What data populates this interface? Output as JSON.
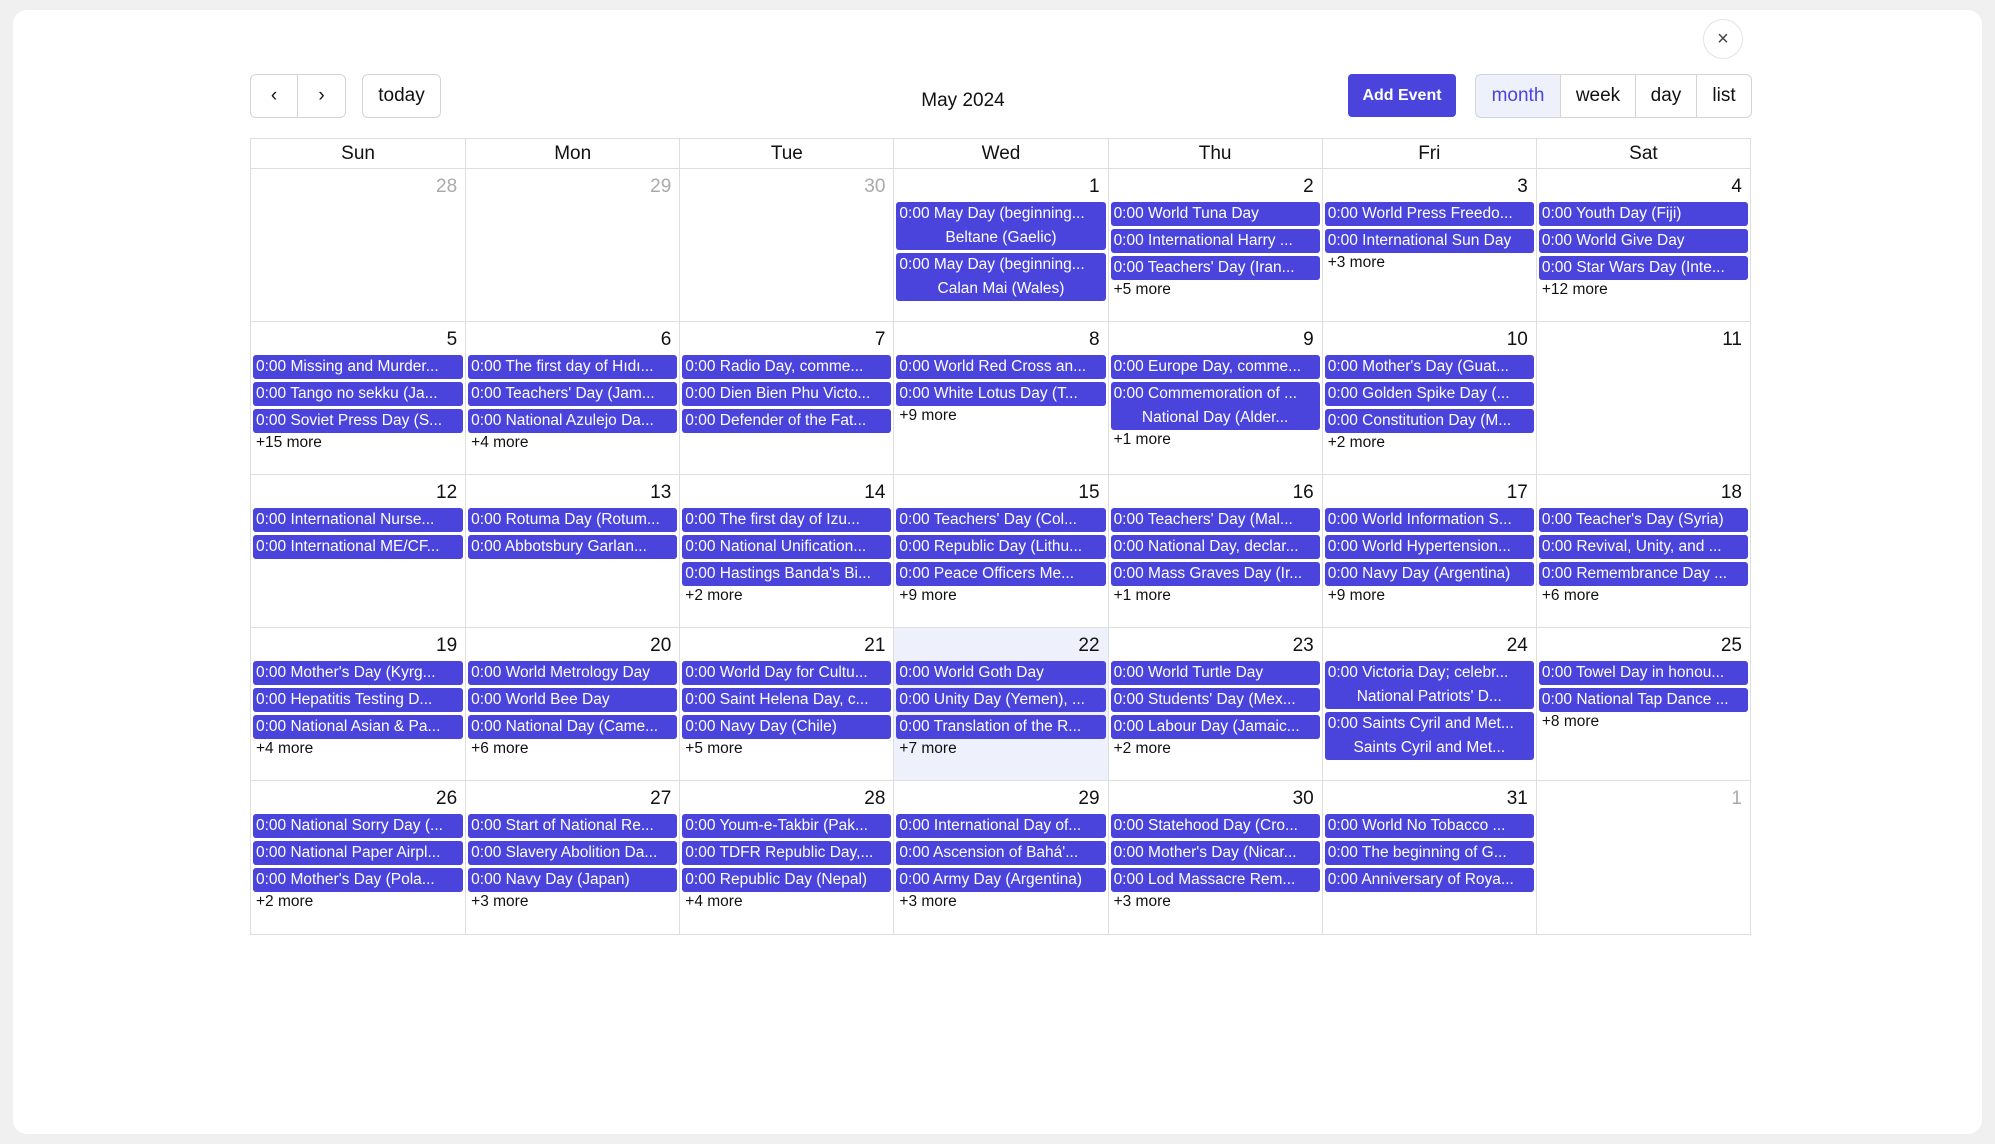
{
  "close_label": "×",
  "toolbar": {
    "prev": "‹",
    "next": "›",
    "today": "today",
    "title": "May 2024",
    "add_event": "Add Event",
    "views": [
      "month",
      "week",
      "day",
      "list"
    ],
    "active_view": "month"
  },
  "accent": "#4a44dd",
  "dow": [
    "Sun",
    "Mon",
    "Tue",
    "Wed",
    "Thu",
    "Fri",
    "Sat"
  ],
  "weeks": [
    [
      {
        "day": "28",
        "other": true,
        "events": [],
        "more": ""
      },
      {
        "day": "29",
        "other": true,
        "events": [],
        "more": ""
      },
      {
        "day": "30",
        "other": true,
        "events": [],
        "more": ""
      },
      {
        "day": "1",
        "events": [
          [
            "0:00 May Day (beginning...",
            "Beltane (Gaelic)"
          ],
          [
            "0:00 May Day (beginning...",
            "Calan Mai (Wales)"
          ]
        ],
        "more": ""
      },
      {
        "day": "2",
        "events": [
          "0:00 World Tuna Day",
          "0:00 International Harry ...",
          "0:00 Teachers' Day (Iran..."
        ],
        "more": "+5 more"
      },
      {
        "day": "3",
        "events": [
          "0:00 World Press Freedo...",
          "0:00 International Sun Day"
        ],
        "more": "+3 more"
      },
      {
        "day": "4",
        "events": [
          "0:00 Youth Day (Fiji)",
          "0:00 World Give Day",
          "0:00 Star Wars Day (Inte..."
        ],
        "more": "+12 more"
      }
    ],
    [
      {
        "day": "5",
        "events": [
          "0:00 Missing and Murder...",
          "0:00 Tango no sekku (Ja...",
          "0:00 Soviet Press Day (S..."
        ],
        "more": "+15 more"
      },
      {
        "day": "6",
        "events": [
          "0:00 The first day of Hıdı...",
          "0:00 Teachers' Day (Jam...",
          "0:00 National Azulejo Da..."
        ],
        "more": "+4 more"
      },
      {
        "day": "7",
        "events": [
          "0:00 Radio Day, comme...",
          "0:00 Dien Bien Phu Victo...",
          "0:00 Defender of the Fat..."
        ],
        "more": ""
      },
      {
        "day": "8",
        "events": [
          "0:00 World Red Cross an...",
          "0:00 White Lotus Day (T..."
        ],
        "more": "+9 more"
      },
      {
        "day": "9",
        "events": [
          "0:00 Europe Day, comme...",
          [
            "0:00 Commemoration of ...",
            "National Day (Alder..."
          ]
        ],
        "more": "+1 more"
      },
      {
        "day": "10",
        "events": [
          "0:00 Mother's Day (Guat...",
          "0:00 Golden Spike Day (...",
          "0:00 Constitution Day (M..."
        ],
        "more": "+2 more"
      },
      {
        "day": "11",
        "events": [],
        "more": ""
      }
    ],
    [
      {
        "day": "12",
        "events": [
          "0:00 International Nurse...",
          "0:00 International ME/CF..."
        ],
        "more": ""
      },
      {
        "day": "13",
        "events": [
          "0:00 Rotuma Day (Rotum...",
          "0:00 Abbotsbury Garlan..."
        ],
        "more": ""
      },
      {
        "day": "14",
        "events": [
          "0:00 The first day of Izu...",
          "0:00 National Unification...",
          "0:00 Hastings Banda's Bi..."
        ],
        "more": "+2 more"
      },
      {
        "day": "15",
        "events": [
          "0:00 Teachers' Day (Col...",
          "0:00 Republic Day (Lithu...",
          "0:00 Peace Officers Me..."
        ],
        "more": "+9 more"
      },
      {
        "day": "16",
        "events": [
          "0:00 Teachers' Day (Mal...",
          "0:00 National Day, declar...",
          "0:00 Mass Graves Day (Ir..."
        ],
        "more": "+1 more"
      },
      {
        "day": "17",
        "events": [
          "0:00 World Information S...",
          "0:00 World Hypertension...",
          "0:00 Navy Day (Argentina)"
        ],
        "more": "+9 more"
      },
      {
        "day": "18",
        "events": [
          "0:00 Teacher's Day (Syria)",
          "0:00 Revival, Unity, and ...",
          "0:00 Remembrance Day ..."
        ],
        "more": "+6 more"
      }
    ],
    [
      {
        "day": "19",
        "events": [
          "0:00 Mother's Day (Kyrg...",
          "0:00 Hepatitis Testing D...",
          "0:00 National Asian & Pa..."
        ],
        "more": "+4 more"
      },
      {
        "day": "20",
        "events": [
          "0:00 World Metrology Day",
          "0:00 World Bee Day",
          "0:00 National Day (Came..."
        ],
        "more": "+6 more"
      },
      {
        "day": "21",
        "events": [
          "0:00 World Day for Cultu...",
          "0:00 Saint Helena Day, c...",
          "0:00 Navy Day (Chile)"
        ],
        "more": "+5 more"
      },
      {
        "day": "22",
        "today": true,
        "events": [
          "0:00 World Goth Day",
          "0:00 Unity Day (Yemen), ...",
          "0:00 Translation of the R..."
        ],
        "more": "+7 more"
      },
      {
        "day": "23",
        "events": [
          "0:00 World Turtle Day",
          "0:00 Students' Day (Mex...",
          "0:00 Labour Day (Jamaic..."
        ],
        "more": "+2 more"
      },
      {
        "day": "24",
        "events": [
          [
            "0:00 Victoria Day; celebr...",
            "National Patriots' D..."
          ],
          [
            "0:00 Saints Cyril and Met...",
            "Saints Cyril and Met..."
          ]
        ],
        "more": ""
      },
      {
        "day": "25",
        "events": [
          "0:00 Towel Day in honou...",
          "0:00 National Tap Dance ..."
        ],
        "more": "+8 more"
      }
    ],
    [
      {
        "day": "26",
        "events": [
          "0:00 National Sorry Day (...",
          "0:00 National Paper Airpl...",
          "0:00 Mother's Day (Pola..."
        ],
        "more": "+2 more"
      },
      {
        "day": "27",
        "events": [
          "0:00 Start of National Re...",
          "0:00 Slavery Abolition Da...",
          "0:00 Navy Day (Japan)"
        ],
        "more": "+3 more"
      },
      {
        "day": "28",
        "events": [
          "0:00 Youm-e-Takbir (Pak...",
          "0:00 TDFR Republic Day,...",
          "0:00 Republic Day (Nepal)"
        ],
        "more": "+4 more"
      },
      {
        "day": "29",
        "events": [
          "0:00 International Day of...",
          "0:00 Ascension of Bahá'...",
          "0:00 Army Day (Argentina)"
        ],
        "more": "+3 more"
      },
      {
        "day": "30",
        "events": [
          "0:00 Statehood Day (Cro...",
          "0:00 Mother's Day (Nicar...",
          "0:00 Lod Massacre Rem..."
        ],
        "more": "+3 more"
      },
      {
        "day": "31",
        "events": [
          "0:00 World No Tobacco ...",
          "0:00 The beginning of G...",
          "0:00 Anniversary of Roya..."
        ],
        "more": ""
      },
      {
        "day": "1",
        "other": true,
        "events": [],
        "more": ""
      }
    ]
  ]
}
